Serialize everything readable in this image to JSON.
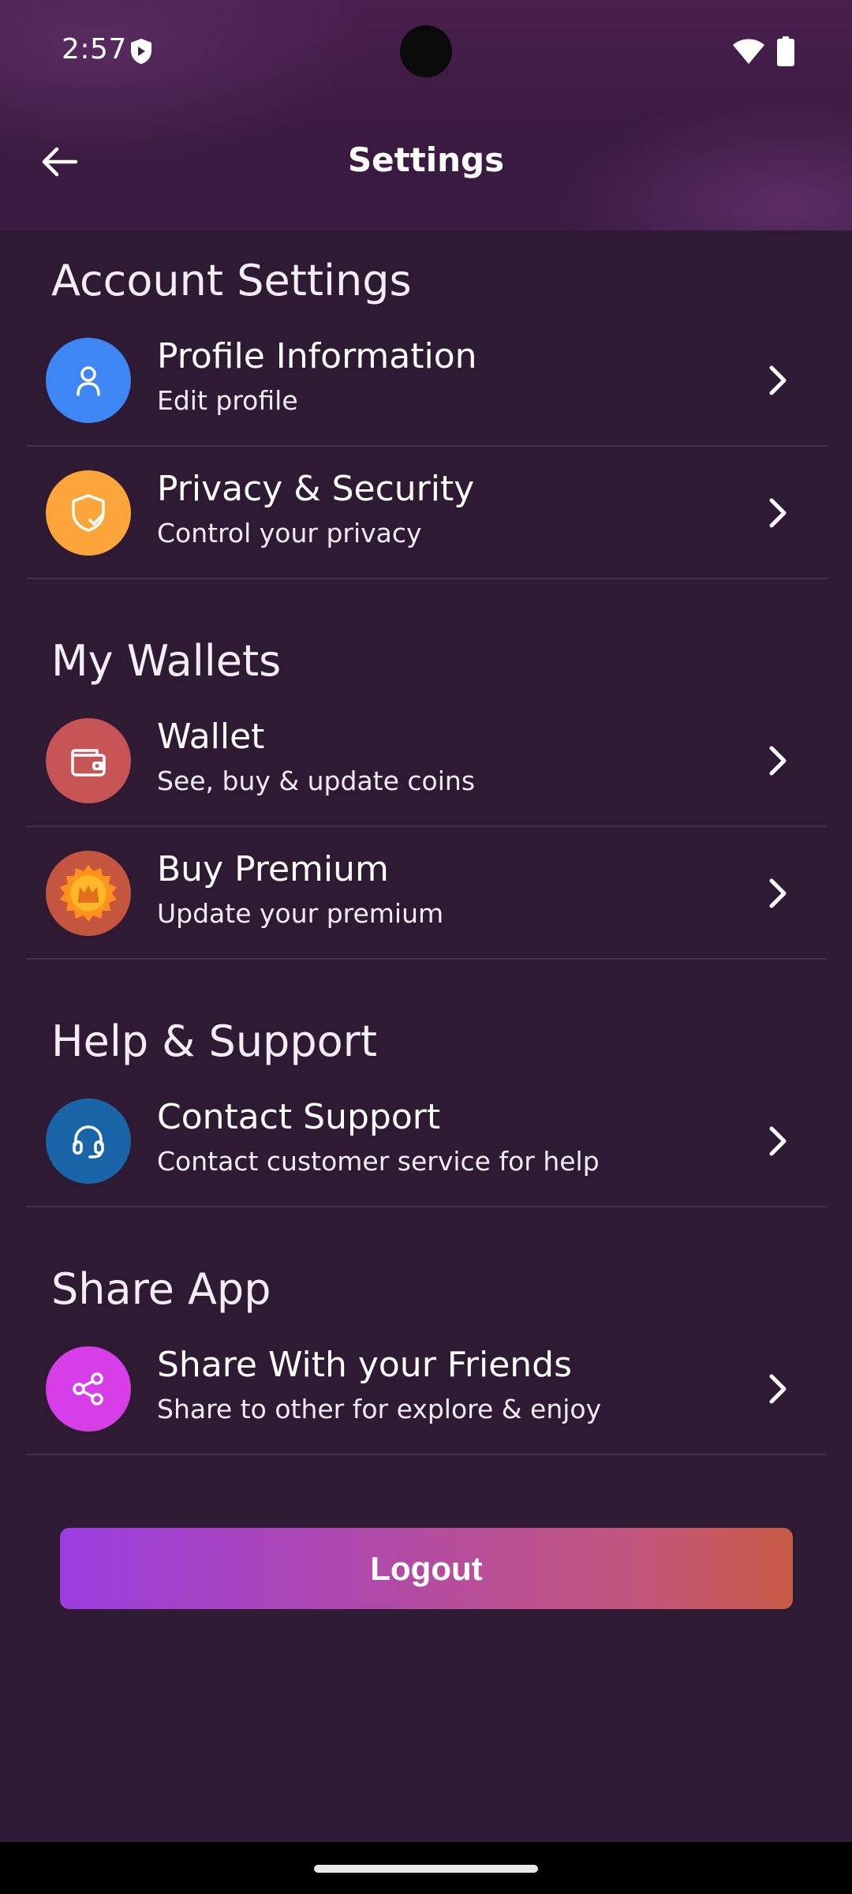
{
  "status_bar": {
    "time": "2:57"
  },
  "app_bar": {
    "title": "Settings"
  },
  "sections": [
    {
      "title": "Account Settings",
      "items": [
        {
          "title": "Profile Information",
          "subtitle": "Edit profile",
          "icon": "user-icon",
          "color": "#3f86f5"
        },
        {
          "title": "Privacy & Security",
          "subtitle": "Control your privacy",
          "icon": "shield-check-icon",
          "color": "#fca53a"
        }
      ]
    },
    {
      "title": "My Wallets",
      "items": [
        {
          "title": "Wallet",
          "subtitle": "See, buy & update coins",
          "icon": "wallet-icon",
          "color": "#c85555"
        },
        {
          "title": "Buy Premium",
          "subtitle": "Update your premium",
          "icon": "crown-icon",
          "color": "#c4553e"
        }
      ]
    },
    {
      "title": "Help & Support",
      "items": [
        {
          "title": "Contact Support",
          "subtitle": "Contact customer service for help",
          "icon": "headset-icon",
          "color": "#1a64a8"
        }
      ]
    },
    {
      "title": "Share App",
      "items": [
        {
          "title": "Share With your Friends",
          "subtitle": "Share to other for explore & enjoy",
          "icon": "share-icon",
          "color": "#d63ee8"
        }
      ]
    }
  ],
  "logout_label": "Logout"
}
